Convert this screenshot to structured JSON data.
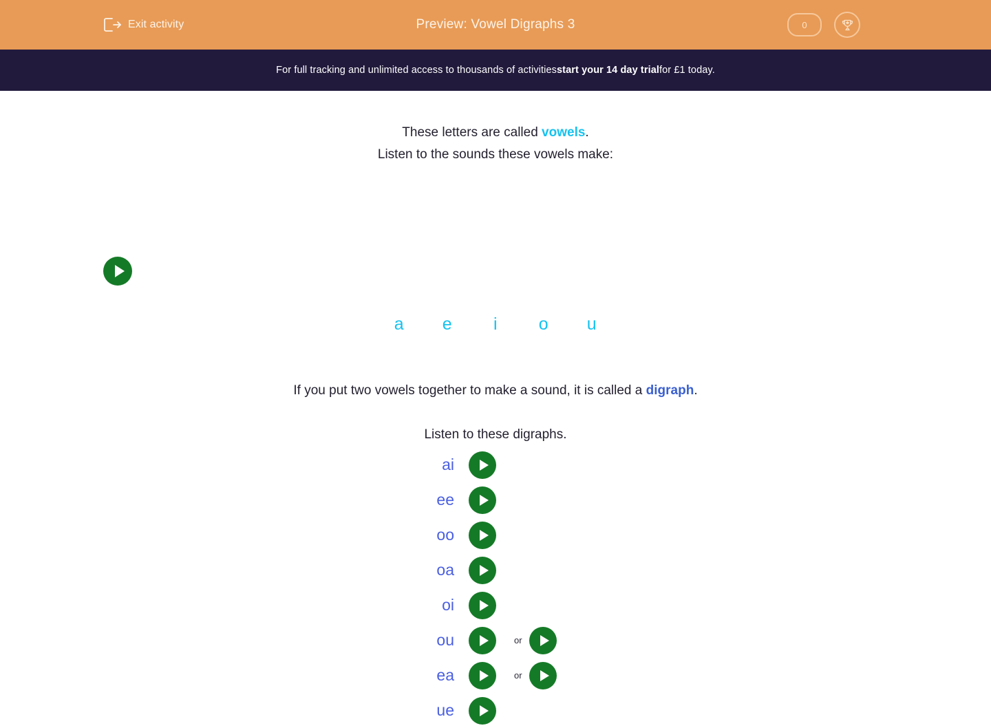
{
  "header": {
    "exit_label": "Exit activity",
    "exit_icon": "exit-door-arrow-icon",
    "title": "Preview: Vowel Digraphs 3",
    "score": "0",
    "trophy_icon": "trophy-star-icon",
    "background_color": "#e89b56",
    "text_color": "#fdf3e9"
  },
  "promo": {
    "lead": "For full tracking and unlimited access to thousands of activities ",
    "emphasis": "start your 14 day trial",
    "tail": " for £1 today.",
    "background_color": "#221a3c"
  },
  "activity": {
    "intro_line1_prefix": "These letters are called ",
    "intro_keyword": "vowels",
    "intro_line1_suffix": ".",
    "intro_line2": "Listen to the sounds these vowels make:",
    "vowels": [
      "a",
      "e",
      "i",
      "o",
      "u"
    ],
    "vowel_color": "#16c2ef",
    "digraph_sentence_prefix": "If you put two vowels together to make a sound, it is called a ",
    "digraph_keyword": "digraph",
    "digraph_sentence_suffix": ".",
    "digraph_keyword_color": "#3a5fd0",
    "listen_digraphs_label": "Listen to these digraphs.",
    "or_label": "or",
    "play_icon": "play-icon",
    "play_color": "#157a27",
    "digraph_label_color": "#4a5fe0",
    "digraphs": [
      {
        "label": "ai",
        "alt": false
      },
      {
        "label": "ee",
        "alt": false
      },
      {
        "label": "oo",
        "alt": false
      },
      {
        "label": "oa",
        "alt": false
      },
      {
        "label": "oi",
        "alt": false
      },
      {
        "label": "ou",
        "alt": true
      },
      {
        "label": "ea",
        "alt": true
      },
      {
        "label": "ue",
        "alt": false
      }
    ]
  }
}
